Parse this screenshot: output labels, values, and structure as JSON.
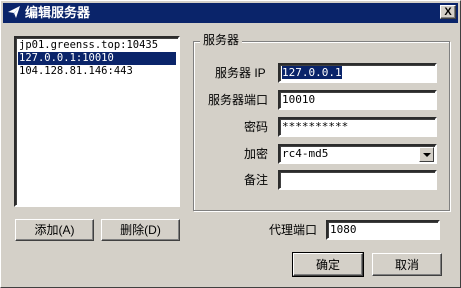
{
  "window": {
    "title": "编辑服务器",
    "close_label": "X"
  },
  "server_list": {
    "items": [
      {
        "text": "jp01.greenss.top:10435",
        "selected": false
      },
      {
        "text": "127.0.0.1:10010",
        "selected": true
      },
      {
        "text": "104.128.81.146:443",
        "selected": false
      }
    ]
  },
  "server_group": {
    "title": "服务器",
    "server_ip_label": "服务器 IP",
    "server_ip_value": "127.0.0.1",
    "server_port_label": "服务器端口",
    "server_port_value": "10010",
    "password_label": "密码",
    "password_value": "**********",
    "encryption_label": "加密",
    "encryption_value": "rc4-md5",
    "remarks_label": "备注",
    "remarks_value": ""
  },
  "proxy": {
    "port_label": "代理端口",
    "port_value": "1080"
  },
  "buttons": {
    "add": "添加(A)",
    "delete": "删除(D)",
    "ok": "确定",
    "cancel": "取消"
  }
}
